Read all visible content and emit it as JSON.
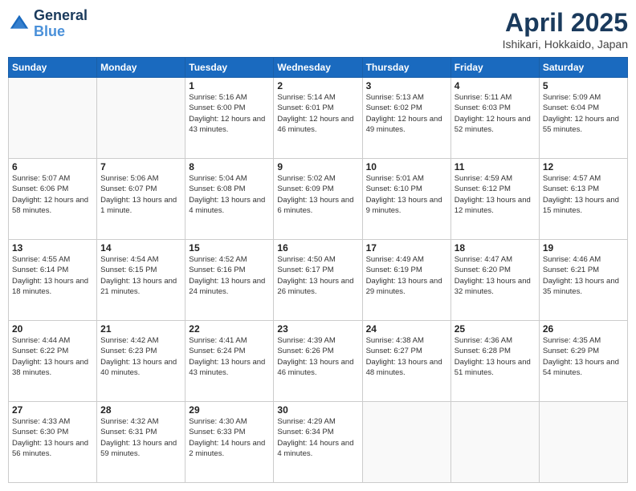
{
  "header": {
    "logo_line1": "General",
    "logo_line2": "Blue",
    "month": "April 2025",
    "location": "Ishikari, Hokkaido, Japan"
  },
  "days_of_week": [
    "Sunday",
    "Monday",
    "Tuesday",
    "Wednesday",
    "Thursday",
    "Friday",
    "Saturday"
  ],
  "weeks": [
    [
      {
        "day": "",
        "info": ""
      },
      {
        "day": "",
        "info": ""
      },
      {
        "day": "1",
        "info": "Sunrise: 5:16 AM\nSunset: 6:00 PM\nDaylight: 12 hours and 43 minutes."
      },
      {
        "day": "2",
        "info": "Sunrise: 5:14 AM\nSunset: 6:01 PM\nDaylight: 12 hours and 46 minutes."
      },
      {
        "day": "3",
        "info": "Sunrise: 5:13 AM\nSunset: 6:02 PM\nDaylight: 12 hours and 49 minutes."
      },
      {
        "day": "4",
        "info": "Sunrise: 5:11 AM\nSunset: 6:03 PM\nDaylight: 12 hours and 52 minutes."
      },
      {
        "day": "5",
        "info": "Sunrise: 5:09 AM\nSunset: 6:04 PM\nDaylight: 12 hours and 55 minutes."
      }
    ],
    [
      {
        "day": "6",
        "info": "Sunrise: 5:07 AM\nSunset: 6:06 PM\nDaylight: 12 hours and 58 minutes."
      },
      {
        "day": "7",
        "info": "Sunrise: 5:06 AM\nSunset: 6:07 PM\nDaylight: 13 hours and 1 minute."
      },
      {
        "day": "8",
        "info": "Sunrise: 5:04 AM\nSunset: 6:08 PM\nDaylight: 13 hours and 4 minutes."
      },
      {
        "day": "9",
        "info": "Sunrise: 5:02 AM\nSunset: 6:09 PM\nDaylight: 13 hours and 6 minutes."
      },
      {
        "day": "10",
        "info": "Sunrise: 5:01 AM\nSunset: 6:10 PM\nDaylight: 13 hours and 9 minutes."
      },
      {
        "day": "11",
        "info": "Sunrise: 4:59 AM\nSunset: 6:12 PM\nDaylight: 13 hours and 12 minutes."
      },
      {
        "day": "12",
        "info": "Sunrise: 4:57 AM\nSunset: 6:13 PM\nDaylight: 13 hours and 15 minutes."
      }
    ],
    [
      {
        "day": "13",
        "info": "Sunrise: 4:55 AM\nSunset: 6:14 PM\nDaylight: 13 hours and 18 minutes."
      },
      {
        "day": "14",
        "info": "Sunrise: 4:54 AM\nSunset: 6:15 PM\nDaylight: 13 hours and 21 minutes."
      },
      {
        "day": "15",
        "info": "Sunrise: 4:52 AM\nSunset: 6:16 PM\nDaylight: 13 hours and 24 minutes."
      },
      {
        "day": "16",
        "info": "Sunrise: 4:50 AM\nSunset: 6:17 PM\nDaylight: 13 hours and 26 minutes."
      },
      {
        "day": "17",
        "info": "Sunrise: 4:49 AM\nSunset: 6:19 PM\nDaylight: 13 hours and 29 minutes."
      },
      {
        "day": "18",
        "info": "Sunrise: 4:47 AM\nSunset: 6:20 PM\nDaylight: 13 hours and 32 minutes."
      },
      {
        "day": "19",
        "info": "Sunrise: 4:46 AM\nSunset: 6:21 PM\nDaylight: 13 hours and 35 minutes."
      }
    ],
    [
      {
        "day": "20",
        "info": "Sunrise: 4:44 AM\nSunset: 6:22 PM\nDaylight: 13 hours and 38 minutes."
      },
      {
        "day": "21",
        "info": "Sunrise: 4:42 AM\nSunset: 6:23 PM\nDaylight: 13 hours and 40 minutes."
      },
      {
        "day": "22",
        "info": "Sunrise: 4:41 AM\nSunset: 6:24 PM\nDaylight: 13 hours and 43 minutes."
      },
      {
        "day": "23",
        "info": "Sunrise: 4:39 AM\nSunset: 6:26 PM\nDaylight: 13 hours and 46 minutes."
      },
      {
        "day": "24",
        "info": "Sunrise: 4:38 AM\nSunset: 6:27 PM\nDaylight: 13 hours and 48 minutes."
      },
      {
        "day": "25",
        "info": "Sunrise: 4:36 AM\nSunset: 6:28 PM\nDaylight: 13 hours and 51 minutes."
      },
      {
        "day": "26",
        "info": "Sunrise: 4:35 AM\nSunset: 6:29 PM\nDaylight: 13 hours and 54 minutes."
      }
    ],
    [
      {
        "day": "27",
        "info": "Sunrise: 4:33 AM\nSunset: 6:30 PM\nDaylight: 13 hours and 56 minutes."
      },
      {
        "day": "28",
        "info": "Sunrise: 4:32 AM\nSunset: 6:31 PM\nDaylight: 13 hours and 59 minutes."
      },
      {
        "day": "29",
        "info": "Sunrise: 4:30 AM\nSunset: 6:33 PM\nDaylight: 14 hours and 2 minutes."
      },
      {
        "day": "30",
        "info": "Sunrise: 4:29 AM\nSunset: 6:34 PM\nDaylight: 14 hours and 4 minutes."
      },
      {
        "day": "",
        "info": ""
      },
      {
        "day": "",
        "info": ""
      },
      {
        "day": "",
        "info": ""
      }
    ]
  ]
}
